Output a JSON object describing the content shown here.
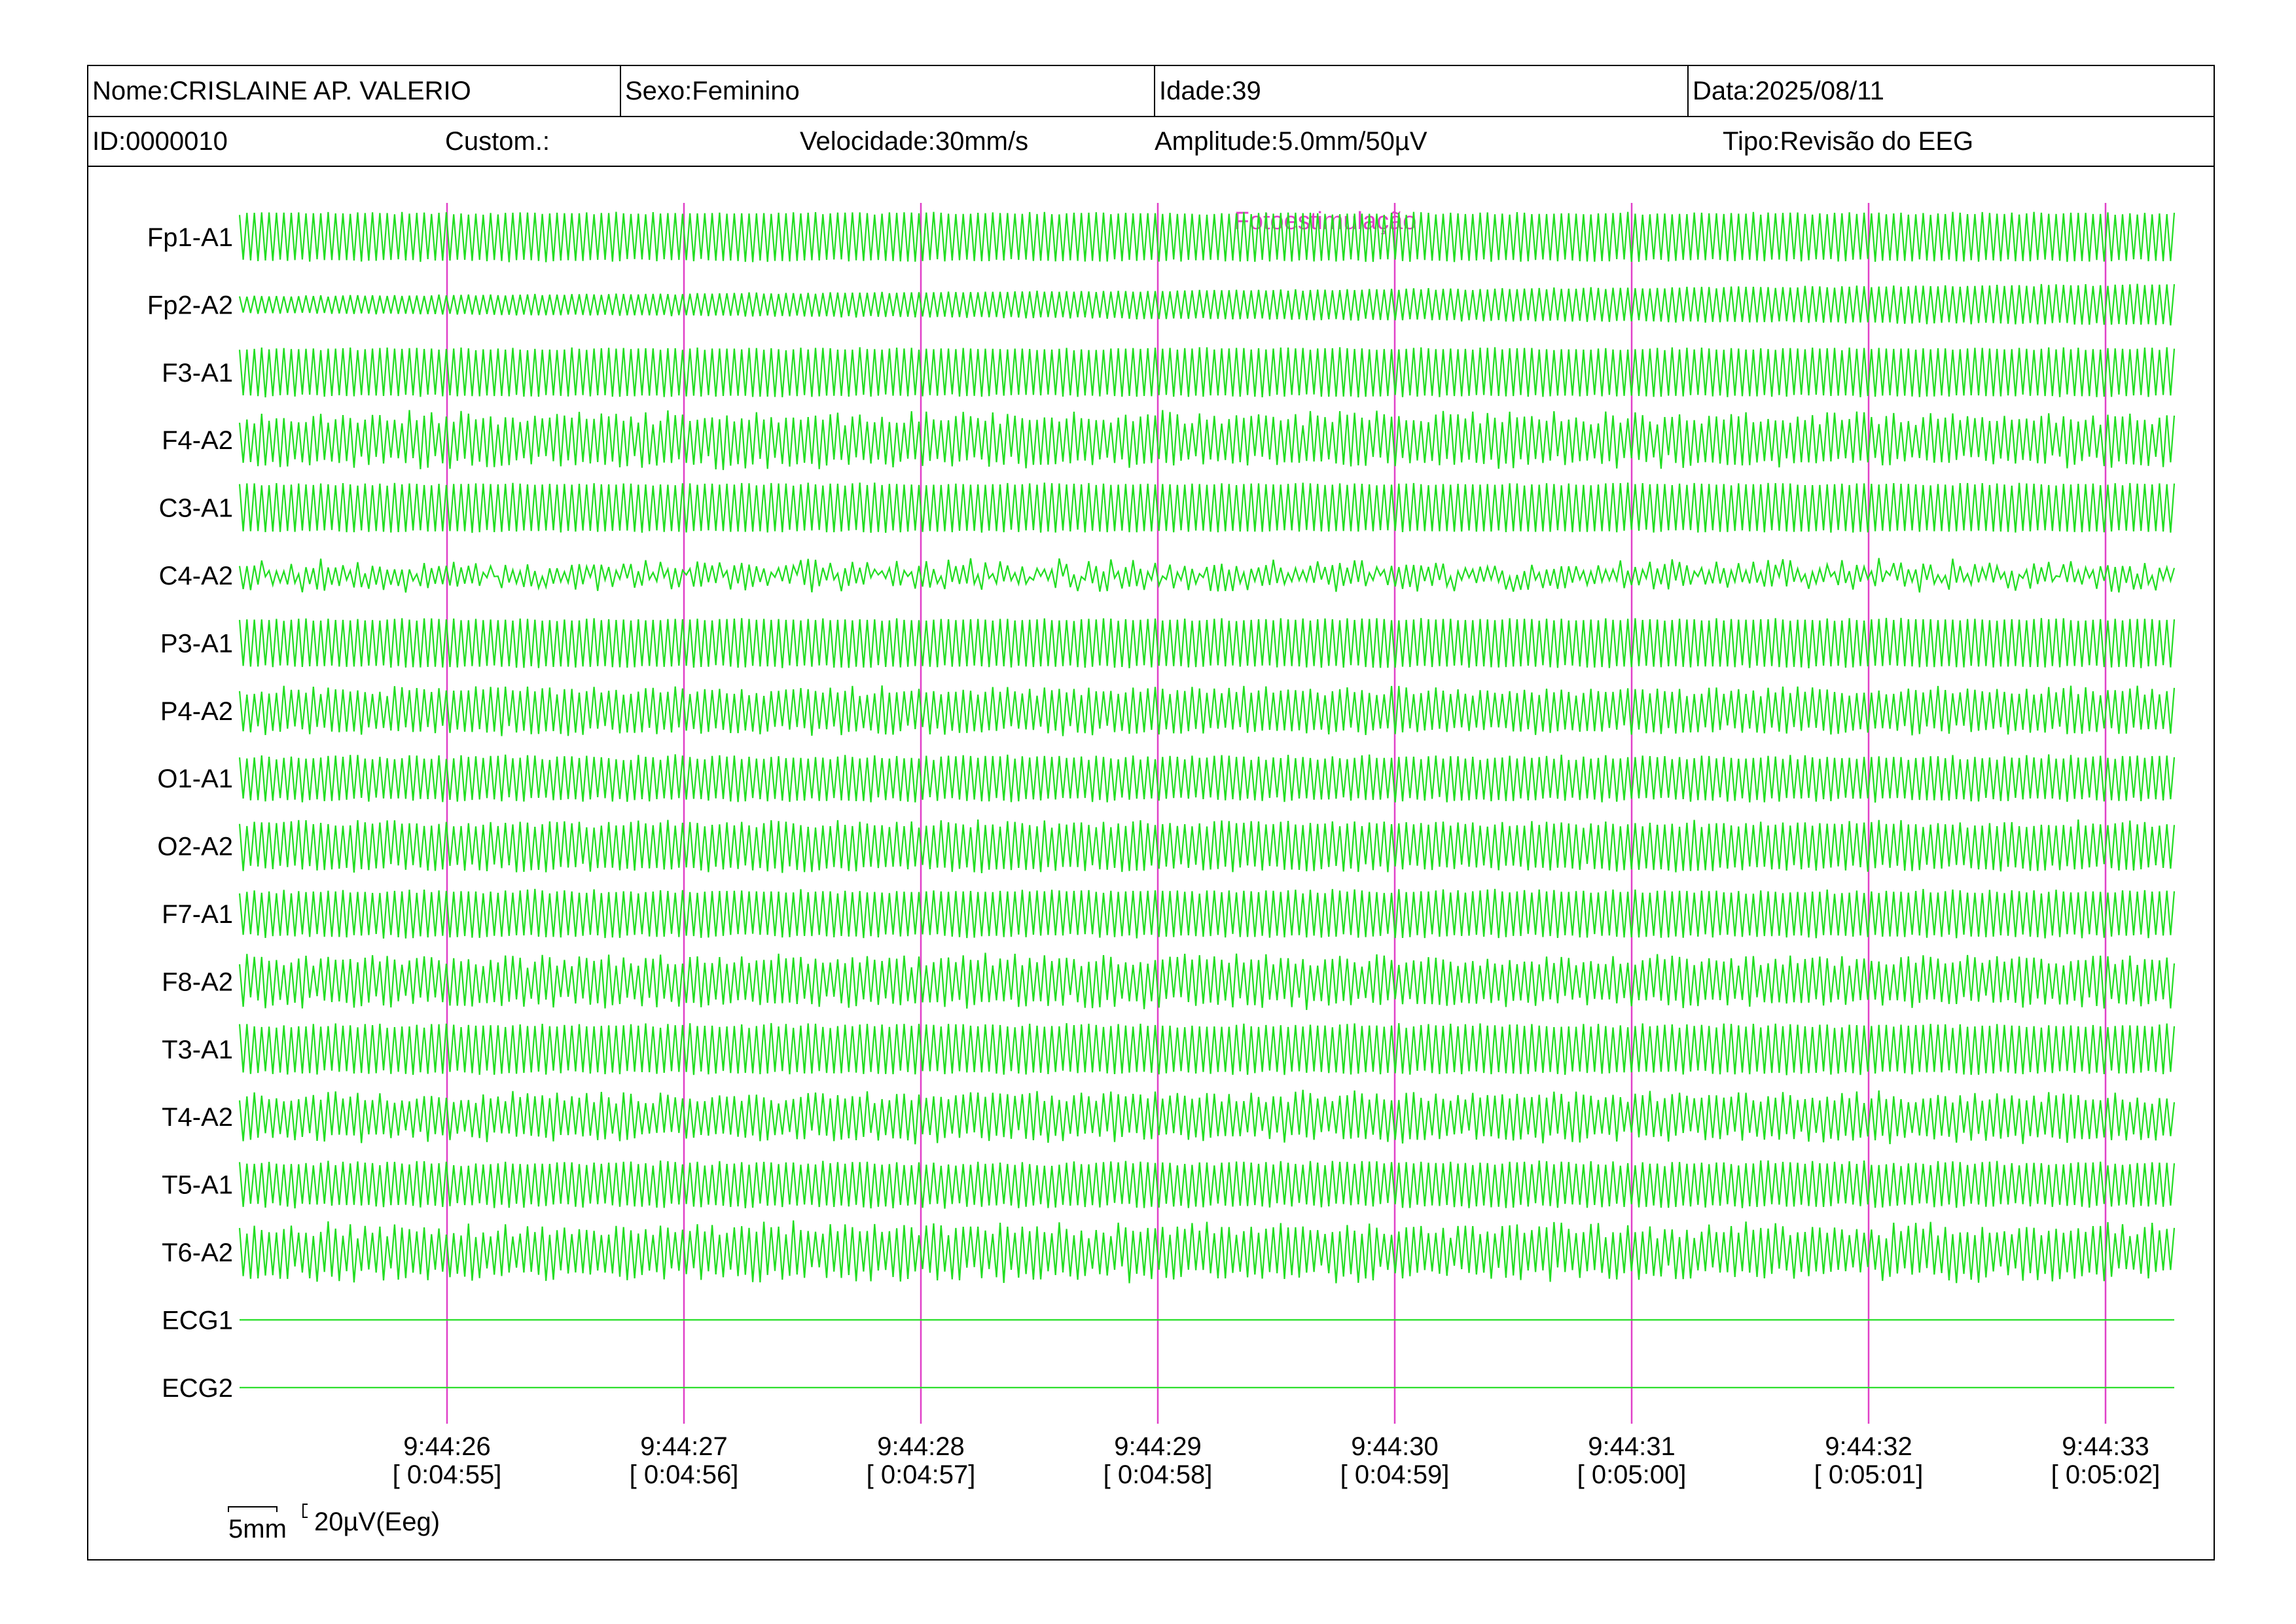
{
  "header": {
    "name": "Nome:CRISLAINE AP. VALERIO",
    "sex": "Sexo:Feminino",
    "age": "Idade:39",
    "date": "Data:2025/08/11",
    "id": "ID:0000010",
    "custom": "Custom.:",
    "speed": "Velocidade:30mm/s",
    "amplitude": "Amplitude:5.0mm/50µV",
    "type": "Tipo:Revisão do EEG"
  },
  "event_marker": "Fotoestimulação",
  "channels": [
    {
      "label": "Fp1-A1",
      "amp": 1.0,
      "noise": 0.05
    },
    {
      "label": "Fp2-A2",
      "amp": 0.35,
      "noise": 0.05,
      "grow": true
    },
    {
      "label": "F3-A1",
      "amp": 1.0,
      "noise": 0.05
    },
    {
      "label": "F4-A2",
      "amp": 0.95,
      "noise": 0.25
    },
    {
      "label": "C3-A1",
      "amp": 1.0,
      "noise": 0.05
    },
    {
      "label": "C4-A2",
      "amp": 0.35,
      "noise": 0.6
    },
    {
      "label": "P3-A1",
      "amp": 1.0,
      "noise": 0.05
    },
    {
      "label": "P4-A2",
      "amp": 0.85,
      "noise": 0.2
    },
    {
      "label": "O1-A1",
      "amp": 0.9,
      "noise": 0.1
    },
    {
      "label": "O2-A2",
      "amp": 0.95,
      "noise": 0.15
    },
    {
      "label": "F7-A1",
      "amp": 0.95,
      "noise": 0.08
    },
    {
      "label": "F8-A2",
      "amp": 0.9,
      "noise": 0.25
    },
    {
      "label": "T3-A1",
      "amp": 1.0,
      "noise": 0.08
    },
    {
      "label": "T4-A2",
      "amp": 0.85,
      "noise": 0.25
    },
    {
      "label": "T5-A1",
      "amp": 0.9,
      "noise": 0.1
    },
    {
      "label": "T6-A2",
      "amp": 0.95,
      "noise": 0.3
    },
    {
      "label": "ECG1",
      "amp": 0,
      "noise": 0
    },
    {
      "label": "ECG2",
      "amp": 0,
      "noise": 0
    }
  ],
  "time_marks": [
    {
      "clock": "9:44:26",
      "elapsed": "[ 0:04:55]"
    },
    {
      "clock": "9:44:27",
      "elapsed": "[ 0:04:56]"
    },
    {
      "clock": "9:44:28",
      "elapsed": "[ 0:04:57]"
    },
    {
      "clock": "9:44:29",
      "elapsed": "[ 0:04:58]"
    },
    {
      "clock": "9:44:30",
      "elapsed": "[ 0:04:59]"
    },
    {
      "clock": "9:44:31",
      "elapsed": "[ 0:05:00]"
    },
    {
      "clock": "9:44:32",
      "elapsed": "[ 0:05:01]"
    },
    {
      "clock": "9:44:33",
      "elapsed": "[ 0:05:02]"
    }
  ],
  "scale": {
    "time_label": "5mm",
    "amp_label": "20µV(Eeg)"
  },
  "colors": {
    "trace": "#22dd22",
    "marker": "#e040c8"
  }
}
